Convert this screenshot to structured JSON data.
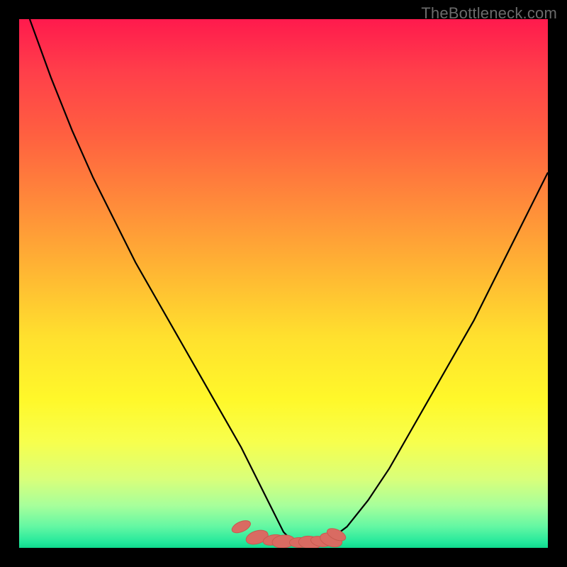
{
  "watermark": "TheBottleneck.com",
  "colors": {
    "border": "#000000",
    "curve": "#000000",
    "marker_fill": "#d96b62",
    "marker_stroke": "#c75a50",
    "top_gradient": "#ff1a4d",
    "bottom_gradient": "#0fd98c"
  },
  "chart_data": {
    "type": "line",
    "title": "",
    "xlabel": "",
    "ylabel": "",
    "xlim": [
      0,
      100
    ],
    "ylim": [
      0,
      100
    ],
    "grid": false,
    "series": [
      {
        "name": "left_branch",
        "x": [
          2,
          6,
          10,
          14,
          18,
          22,
          26,
          30,
          34,
          38,
          42,
          45,
          48,
          50,
          52
        ],
        "y": [
          100,
          89,
          79,
          70,
          62,
          54,
          47,
          40,
          33,
          26,
          19,
          13,
          7,
          3,
          1
        ]
      },
      {
        "name": "right_branch",
        "x": [
          58,
          62,
          66,
          70,
          74,
          78,
          82,
          86,
          90,
          94,
          98,
          100
        ],
        "y": [
          1,
          4,
          9,
          15,
          22,
          29,
          36,
          43,
          51,
          59,
          67,
          71
        ]
      }
    ],
    "valley_markers": {
      "name": "valley_floor",
      "x": [
        42,
        45,
        48,
        50,
        53,
        55,
        57,
        59,
        60
      ],
      "y": [
        4,
        2,
        1.5,
        1.2,
        1,
        1,
        1.2,
        1.5,
        2.5
      ]
    },
    "note": "x and y are in percent of the gradient plot area (0=left/bottom, 100=right/top). Values estimated from pixels; no axes or tick labels are present in the source image."
  }
}
